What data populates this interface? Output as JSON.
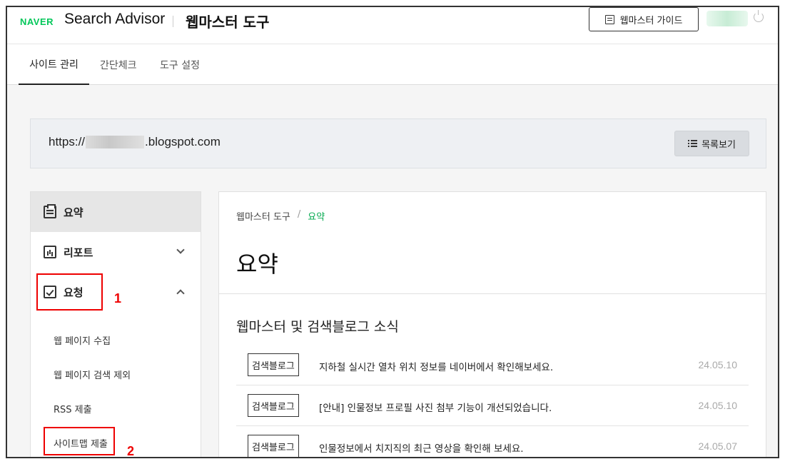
{
  "header": {
    "naver_logo": "NAVER",
    "brand": "Search Advisor",
    "tool_title": "웹마스터 도구",
    "guide_button": "웹마스터 가이드",
    "guide_icon": "book-icon",
    "logout_icon": "power-icon"
  },
  "nav": {
    "tabs": [
      {
        "label": "사이트 관리",
        "active": true
      },
      {
        "label": "간단체크",
        "active": false
      },
      {
        "label": "도구 설정",
        "active": false
      }
    ]
  },
  "site": {
    "url_prefix": "https://",
    "url_suffix": ".blogspot.com",
    "list_button": "목록보기"
  },
  "sidebar": {
    "summary": "요약",
    "report": "리포트",
    "request": "요청",
    "sub_items": [
      "웹 페이지 수집",
      "웹 페이지 검색 제외",
      "RSS 제출",
      "사이트맵 제출"
    ]
  },
  "annotations": {
    "label1": "1",
    "label2": "2",
    "color": "#e00000"
  },
  "main": {
    "breadcrumb": [
      "웹마스터 도구",
      "요약"
    ],
    "breadcrumb_sep": "/",
    "title": "요약",
    "news_heading": "웹마스터 및 검색블로그 소식",
    "news": [
      {
        "tag": "검색블로그",
        "text": "지하철 실시간 열차 위치 정보를 네이버에서 확인해보세요.",
        "date": "24.05.10"
      },
      {
        "tag": "검색블로그",
        "text": "[안내] 인물정보 프로필 사진 첨부 기능이 개선되었습니다.",
        "date": "24.05.10"
      },
      {
        "tag": "검색블로그",
        "text": "인물정보에서 치지직의 최근 영상을 확인해 보세요.",
        "date": "24.05.07"
      }
    ]
  },
  "colors": {
    "accent": "#03c75a",
    "breadcrumb_active": "#03a94e"
  }
}
